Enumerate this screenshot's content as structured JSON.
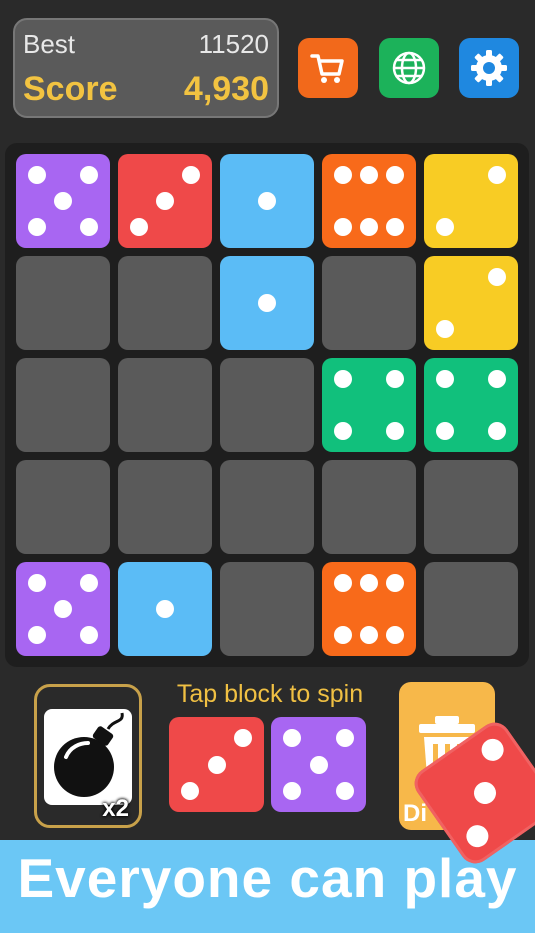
{
  "header": {
    "best_label": "Best",
    "best_value": "11520",
    "score_label": "Score",
    "score_value": "4,930"
  },
  "buttons": {
    "shop_icon": "cart-icon",
    "language_icon": "globe-icon",
    "settings_icon": "gear-icon"
  },
  "colors": {
    "purple": "#a866f2",
    "red": "#ef4949",
    "blue": "#5bbcf6",
    "orange": "#f86a1a",
    "yellow": "#f8cc24",
    "green": "#11c07c",
    "empty": "#5a5a5a"
  },
  "board": {
    "rows": [
      [
        {
          "color": "purple",
          "value": 5
        },
        {
          "color": "red",
          "value": 3
        },
        {
          "color": "blue",
          "value": 1
        },
        {
          "color": "orange",
          "value": 6
        },
        {
          "color": "yellow",
          "value": 2
        }
      ],
      [
        null,
        null,
        {
          "color": "blue",
          "value": 1
        },
        null,
        {
          "color": "yellow",
          "value": 2
        }
      ],
      [
        null,
        null,
        null,
        {
          "color": "green",
          "value": 4
        },
        {
          "color": "green",
          "value": 4
        }
      ],
      [
        null,
        null,
        null,
        null,
        null
      ],
      [
        {
          "color": "purple",
          "value": 5
        },
        {
          "color": "blue",
          "value": 1
        },
        null,
        {
          "color": "orange",
          "value": 6
        },
        null
      ]
    ]
  },
  "hint": "Tap block to spin",
  "powerups": {
    "bomb_icon": "bomb-icon",
    "bomb_count": "x2",
    "trash_icon": "trash-icon",
    "trash_label": "Di"
  },
  "next_piece": [
    {
      "color": "red",
      "value": 3
    },
    {
      "color": "purple",
      "value": 5
    }
  ],
  "floating_die": {
    "color": "red",
    "value": 3
  },
  "banner": {
    "text": "Everyone can play"
  }
}
